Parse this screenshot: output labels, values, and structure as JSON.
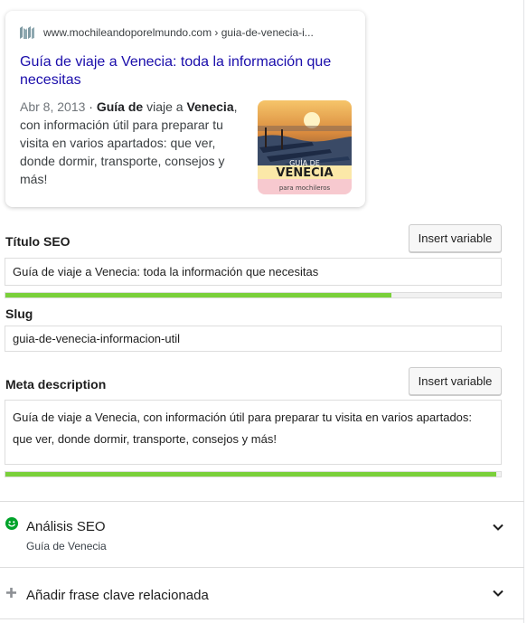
{
  "preview": {
    "url": "www.mochileandoporelmundo.com › guia-de-venecia-i...",
    "title": "Guía de viaje a Venecia: toda la información que necesitas",
    "date": "Abr 8, 2013",
    "separator": " · ",
    "desc_bold1": "Guía de",
    "desc_mid": " viaje a ",
    "desc_bold2": "Venecia",
    "desc_rest": ", con información útil para preparar tu visita en varios apartados: que ver, donde dormir, transporte, consejos y más!",
    "thumb_text_top": "GUÍA DE",
    "thumb_text_main": "VENECIA",
    "thumb_text_sub": "para mochileros"
  },
  "seo_title": {
    "label": "Título SEO",
    "insert_button": "Insert variable",
    "value": "Guía de viaje a Venecia: toda la información que necesitas",
    "progress": 0.78
  },
  "slug": {
    "label": "Slug",
    "value": "guia-de-venecia-informacion-util"
  },
  "meta_description": {
    "label": "Meta description",
    "insert_button": "Insert variable",
    "value": "Guía de viaje a Venecia, con información útil para preparar tu visita en varios apartados: que ver, donde dormir, transporte, consejos y más!",
    "progress": 0.99
  },
  "seo_analysis": {
    "title": "Análisis SEO",
    "subtitle": "Guía de Venecia",
    "status_color": "#00a32a"
  },
  "related_keyphrase": {
    "title": "Añadir frase clave relacionada"
  },
  "colors": {
    "link": "#1a0dab",
    "progress_good": "#7ad03a"
  }
}
